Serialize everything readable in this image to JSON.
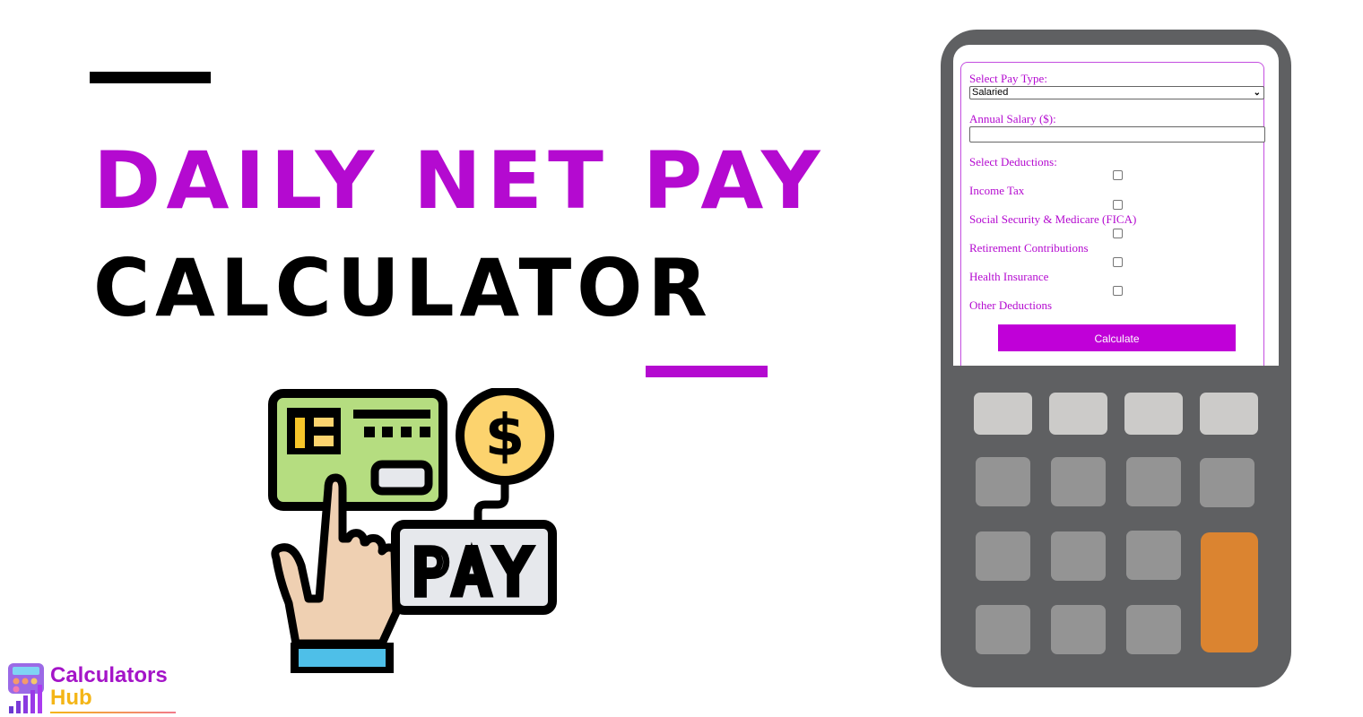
{
  "title": {
    "line1": "DAILY NET PAY",
    "line2": "CALCULATOR"
  },
  "colors": {
    "accent": "#b40ad0",
    "calc_body": "#5f6062",
    "key_light": "#cccbc9",
    "key_mid": "#949494",
    "key_orange": "#db8430"
  },
  "illustration": {
    "icon": "pay-card-hand-icon",
    "pay_label": "PAY",
    "coin_symbol": "$"
  },
  "form": {
    "pay_type_label": "Select Pay Type:",
    "pay_type_value": "Salaried",
    "annual_salary_label": "Annual Salary ($):",
    "annual_salary_value": "",
    "deductions_label": "Select Deductions:",
    "deductions": [
      {
        "label": "Income Tax",
        "checked": false
      },
      {
        "label": "Social Security & Medicare (FICA)",
        "checked": false
      },
      {
        "label": "Retirement Contributions",
        "checked": false
      },
      {
        "label": "Health Insurance",
        "checked": false
      },
      {
        "label": "Other Deductions",
        "checked": false
      }
    ],
    "calculate_label": "Calculate"
  },
  "logo": {
    "line1": "Calculators",
    "line2": "Hub"
  }
}
